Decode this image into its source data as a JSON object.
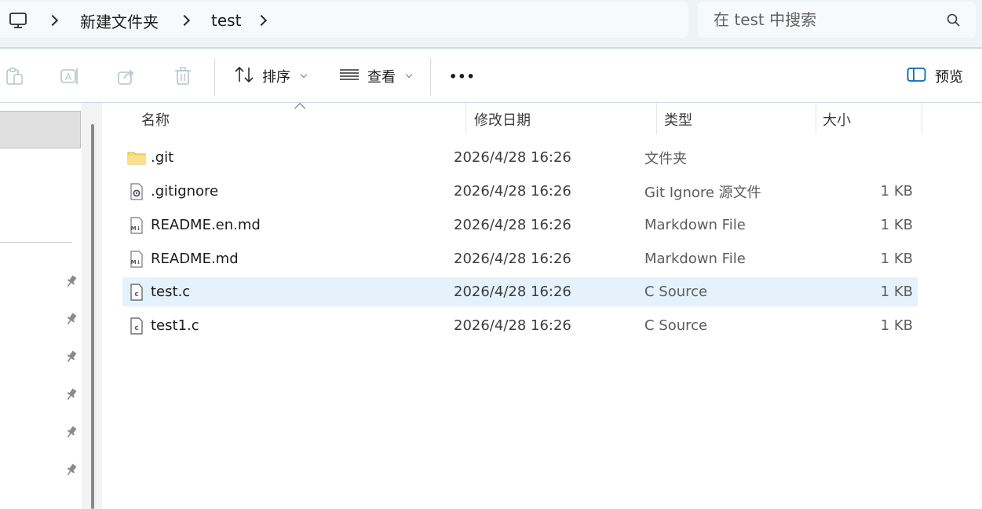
{
  "address_bar": {
    "breadcrumb": [
      "新建文件夹",
      "test"
    ],
    "search_placeholder": "在 test 中搜索"
  },
  "command_bar": {
    "sort_label": "排序",
    "view_label": "查看",
    "more_label": "•••",
    "preview_label": "预览"
  },
  "file_list": {
    "columns": {
      "name": "名称",
      "date": "修改日期",
      "type": "类型",
      "size": "大小"
    },
    "sorted_by": "名称",
    "rows": [
      {
        "name": ".git",
        "date": "2026/4/28 16:26",
        "type": "文件夹",
        "size": "",
        "icon": "folder-icon"
      },
      {
        "name": ".gitignore",
        "date": "2026/4/28 16:26",
        "type": "Git Ignore 源文件",
        "size": "1 KB",
        "icon": "settings-file-icon"
      },
      {
        "name": "README.en.md",
        "date": "2026/4/28 16:26",
        "type": "Markdown File",
        "size": "1 KB",
        "icon": "markdown-file-icon"
      },
      {
        "name": "README.md",
        "date": "2026/4/28 16:26",
        "type": "Markdown File",
        "size": "1 KB",
        "icon": "markdown-file-icon"
      },
      {
        "name": "test.c",
        "date": "2026/4/28 16:26",
        "type": "C Source",
        "size": "1 KB",
        "icon": "c-source-file-icon",
        "selected": true
      },
      {
        "name": "test1.c",
        "date": "2026/4/28 16:26",
        "type": "C Source",
        "size": "1 KB",
        "icon": "c-source-file-icon"
      }
    ]
  },
  "colors": {
    "accent": "#0067c0",
    "selection": "#e5f1fb",
    "chrome": "#eef3f5"
  }
}
